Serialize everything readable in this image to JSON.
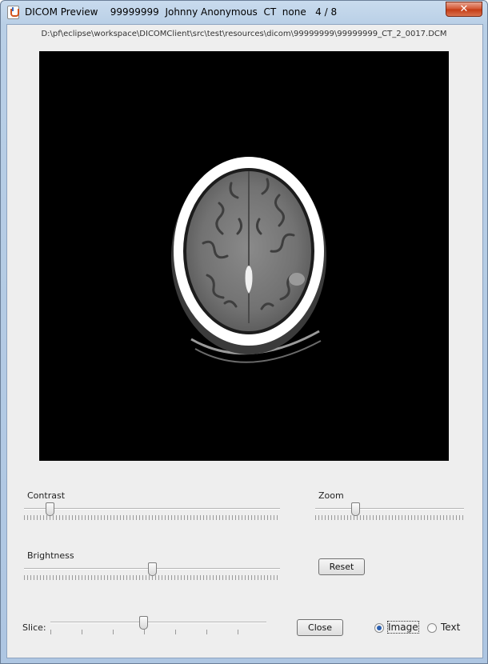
{
  "window": {
    "title": "DICOM Preview    99999999  Johnny Anonymous  CT  none   4 / 8",
    "close_glyph": "✕"
  },
  "file_path": "D:\\pf\\eclipse\\workspace\\DICOMClient\\src\\test\\resources\\dicom\\99999999\\99999999_CT_2_0017.DCM",
  "controls": {
    "contrast": {
      "label": "Contrast",
      "value": 0.1
    },
    "zoom": {
      "label": "Zoom",
      "value": 0.27
    },
    "brightness": {
      "label": "Brightness",
      "value": 0.5
    },
    "slice": {
      "label": "Slice:",
      "value": 0.43
    },
    "reset_label": "Reset",
    "close_label": "Close",
    "view_mode": {
      "options": [
        {
          "label": "Image",
          "selected": true
        },
        {
          "label": "Text",
          "selected": false
        }
      ]
    }
  },
  "colors": {
    "window_frame": "#b9cfe6",
    "client_bg": "#eeeeee",
    "viewer_bg": "#000000",
    "close_button": "#d2522e"
  },
  "icons": {
    "app": "java-cup-icon",
    "close": "close-icon"
  }
}
